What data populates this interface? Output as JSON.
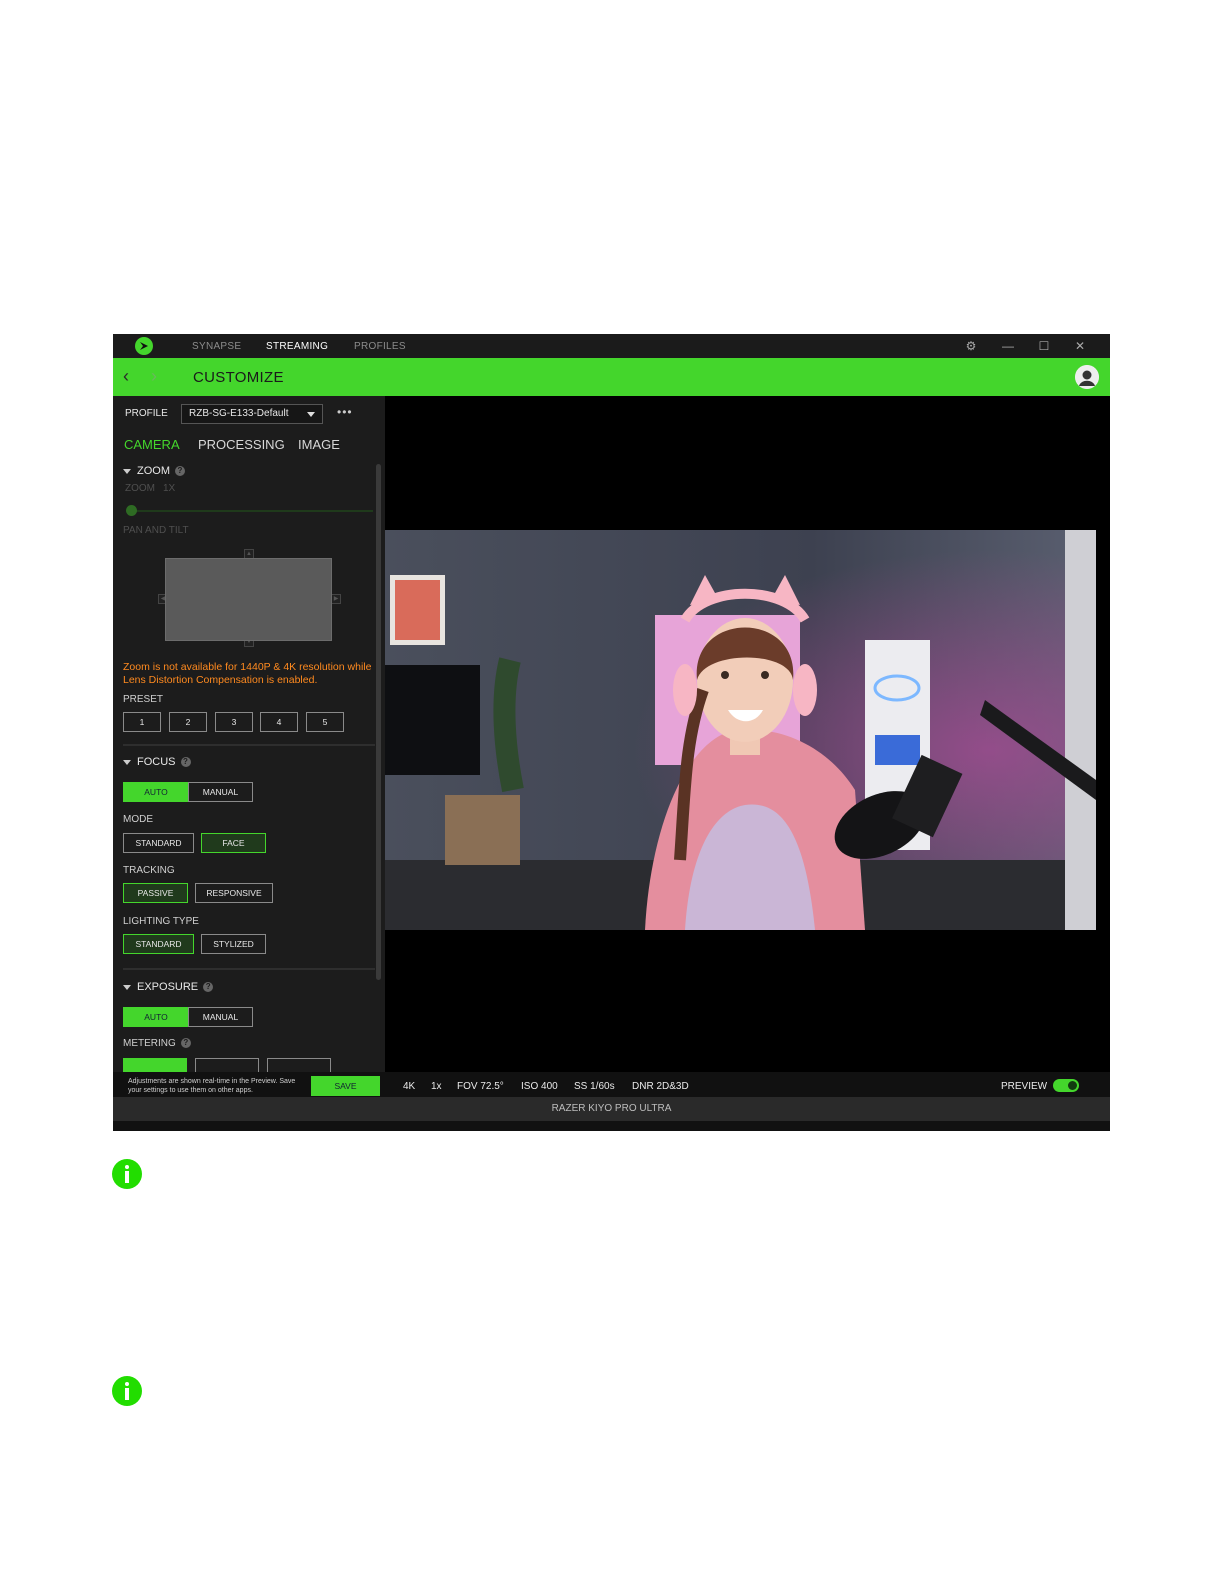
{
  "window": {
    "nav": [
      "SYNAPSE",
      "STREAMING",
      "PROFILES"
    ],
    "active_nav": "STREAMING"
  },
  "header": {
    "title": "CUSTOMIZE"
  },
  "profile": {
    "label": "PROFILE",
    "value": "RZB-SG-E133-Default"
  },
  "tabs": [
    "CAMERA",
    "PROCESSING",
    "IMAGE"
  ],
  "zoom": {
    "title": "ZOOM",
    "zoom_label": "ZOOM",
    "zoom_value": "1x",
    "pan_label": "PAN AND TILT",
    "warning": "Zoom is not available for 1440P & 4K resolution while Lens Distortion Compensation is enabled.",
    "preset_label": "PRESET",
    "presets": [
      "1",
      "2",
      "3",
      "4",
      "5"
    ]
  },
  "focus": {
    "title": "FOCUS",
    "auto": "AUTO",
    "manual": "MANUAL",
    "mode_label": "MODE",
    "mode_options": [
      "STANDARD",
      "FACE"
    ],
    "tracking_label": "TRACKING",
    "tracking_options": [
      "PASSIVE",
      "RESPONSIVE"
    ],
    "lighting_label": "LIGHTING TYPE",
    "lighting_options": [
      "STANDARD",
      "STYLIZED"
    ]
  },
  "exposure": {
    "title": "EXPOSURE",
    "auto": "AUTO",
    "manual": "MANUAL",
    "metering_label": "METERING"
  },
  "bottom": {
    "note": "Adjustments are shown real-time in the Preview. Save your settings to use them on other apps.",
    "save": "SAVE",
    "stats": [
      "4K",
      "1x",
      "FOV 72.5°",
      "ISO 400",
      "SS 1/60s",
      "DNR 2D&3D"
    ],
    "preview_label": "PREVIEW"
  },
  "device": "RAZER KIYO PRO ULTRA",
  "colors": {
    "accent": "#44d62c",
    "warning": "#ff8a1f",
    "info_icon": "#22dd00"
  }
}
